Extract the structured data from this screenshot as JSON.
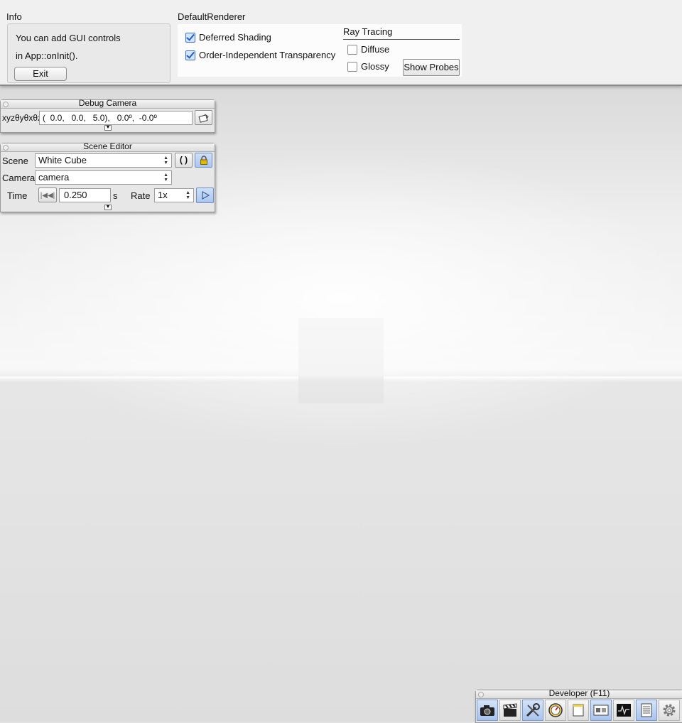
{
  "info": {
    "title": "Info",
    "line1": "You can add GUI controls",
    "line2": "in App::onInit().",
    "exit_label": "Exit"
  },
  "renderer": {
    "title": "DefaultRenderer",
    "deferred_shading": {
      "label": "Deferred Shading",
      "checked": true
    },
    "oit": {
      "label": "Order-Independent Transparency",
      "checked": true
    },
    "ray_tracing": {
      "title": "Ray Tracing",
      "diffuse": {
        "label": "Diffuse",
        "checked": false
      },
      "glossy": {
        "label": "Glossy",
        "checked": false
      },
      "show_probes_label": "Show Probes"
    }
  },
  "debug_camera": {
    "title": "Debug Camera",
    "coord_label": "xyzθyθxθz",
    "value": "(  0.0,   0.0,   5.0),   0.0º,  -0.0º"
  },
  "scene_editor": {
    "title": "Scene Editor",
    "scene_label": "Scene",
    "scene_value": "White Cube",
    "camera_label": "Camera",
    "camera_value": "camera",
    "time_label": "Time",
    "time_value": "0.250",
    "time_unit": "s",
    "rate_label": "Rate",
    "rate_value": "1x"
  },
  "developer": {
    "title": "Developer (F11)",
    "icons": [
      "camera-icon",
      "clapperboard-icon",
      "tools-icon",
      "speedometer-icon",
      "window-icon",
      "scene-icon",
      "profiler-icon",
      "log-icon",
      "settings-gear-icon"
    ]
  }
}
